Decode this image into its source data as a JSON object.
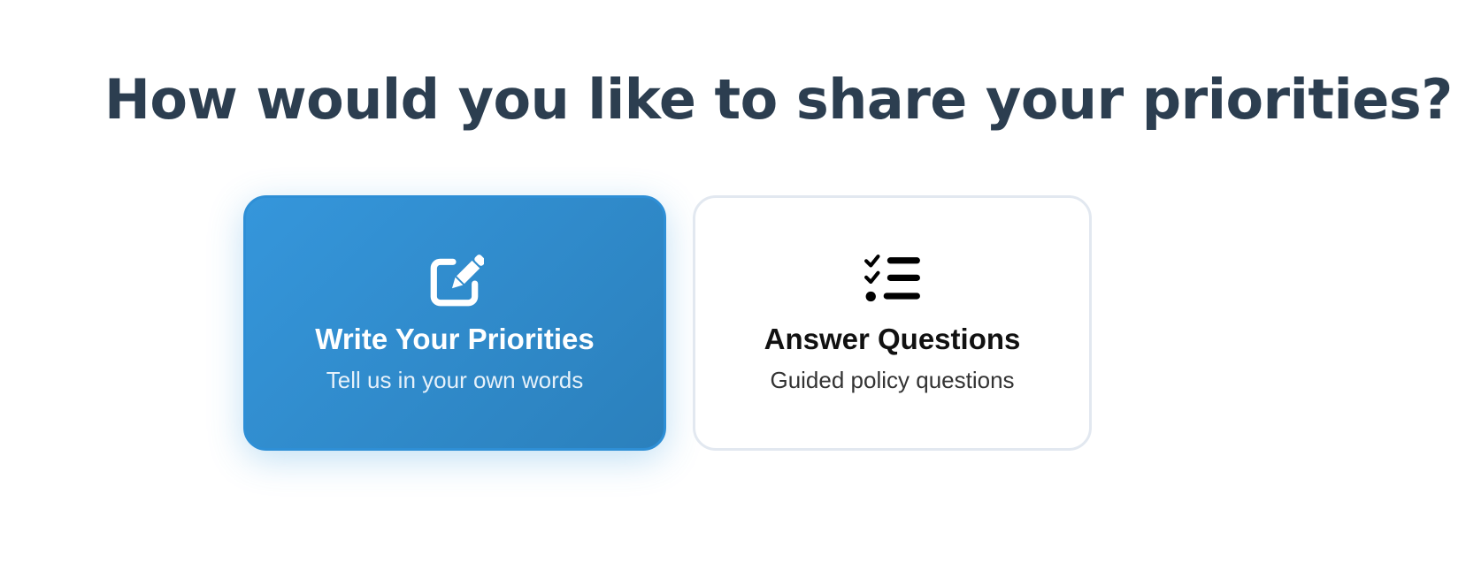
{
  "page": {
    "title": "How would you like to share your priorities?"
  },
  "options": [
    {
      "id": "write",
      "icon": "pencil-square-icon",
      "title": "Write Your Priorities",
      "subtitle": "Tell us in your own words",
      "selected": true
    },
    {
      "id": "answer",
      "icon": "checklist-icon",
      "title": "Answer Questions",
      "subtitle": "Guided policy questions",
      "selected": false
    }
  ],
  "colors": {
    "heading": "#2c3e50",
    "accent": "#3498db",
    "card_border": "#e2e8f0"
  }
}
